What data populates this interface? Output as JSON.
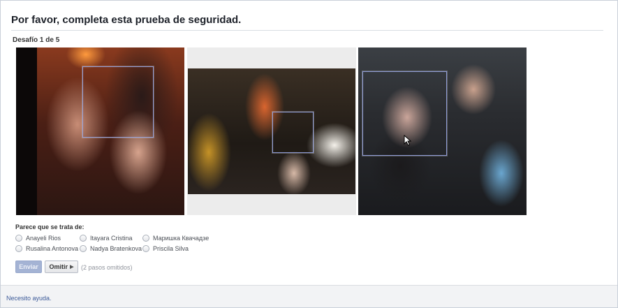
{
  "header": {
    "title": "Por favor, completa esta prueba de seguridad.",
    "step": "Desafío 1 de 5"
  },
  "photos": [
    {
      "label": "photo-1"
    },
    {
      "label": "photo-2"
    },
    {
      "label": "photo-3"
    }
  ],
  "question": {
    "prompt": "Parece que se trata de:",
    "options": [
      "Anayeli Rios",
      "Itayara Cristina",
      "Маришка Квачадзе",
      "Rusalina Antonova",
      "Nadya Bratenkova",
      "Priscila Silva"
    ]
  },
  "actions": {
    "submit_label": "Enviar",
    "skip_label": "Omitir",
    "skipped_note": "(2 pasos omitidos)"
  },
  "footer": {
    "help_link": "Necesito ayuda."
  },
  "colors": {
    "link": "#3b5998",
    "face_box": "#8e9bd6",
    "submit_disabled": "#a4b3d4"
  }
}
